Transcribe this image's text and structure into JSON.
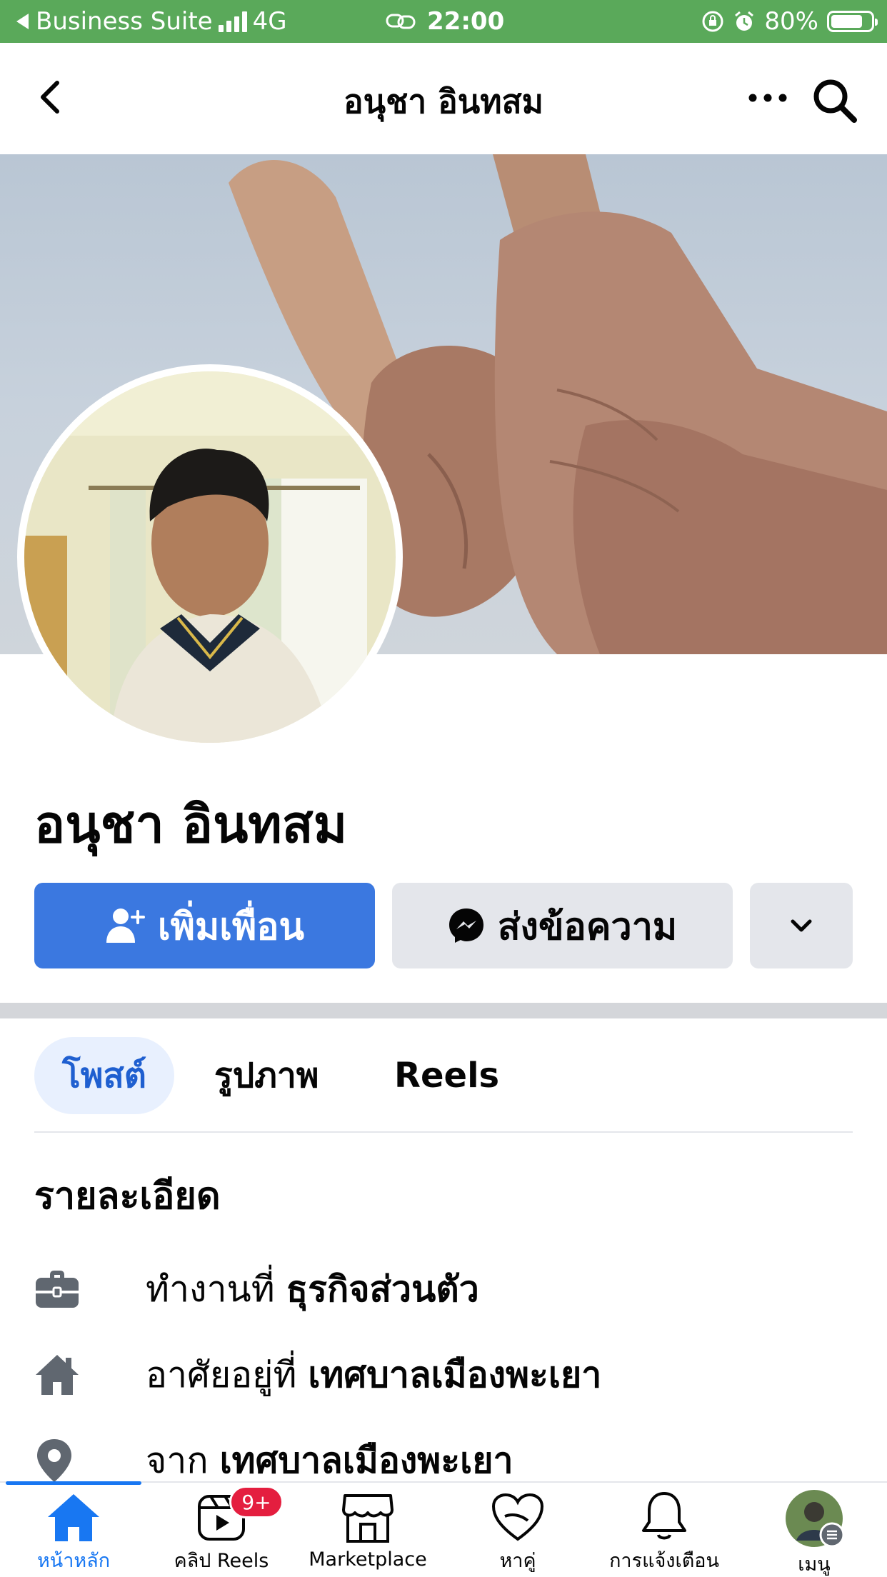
{
  "status_bar": {
    "back_app": "Business Suite",
    "network": "4G",
    "time": "22:00",
    "battery_percent": "80%",
    "battery_level": 0.8
  },
  "header": {
    "title": "อนุชา อินทสม"
  },
  "profile": {
    "name": "อนุชา อินทสม",
    "add_friend_label": "เพิ่มเพื่อน",
    "message_label": "ส่งข้อความ"
  },
  "tabs": [
    {
      "label": "โพสต์",
      "active": true
    },
    {
      "label": "รูปภาพ",
      "active": false
    },
    {
      "label": "Reels",
      "active": false
    }
  ],
  "details": {
    "title": "รายละเอียด",
    "rows": [
      {
        "icon": "briefcase-icon",
        "prefix": "ทำงานที่",
        "value": "ธุรกิจส่วนตัว"
      },
      {
        "icon": "home-icon",
        "prefix": "อาศัยอยู่ที่",
        "value": "เทศบาลเมืองพะเยา"
      },
      {
        "icon": "location-pin-icon",
        "prefix": "จาก",
        "value": "เทศบาลเมืองพะเยา"
      }
    ]
  },
  "bottom_nav": [
    {
      "label": "หน้าหลัก",
      "icon": "home-icon",
      "active": true
    },
    {
      "label": "คลิป Reels",
      "icon": "reels-icon",
      "badge": "9+"
    },
    {
      "label": "Marketplace",
      "icon": "shop-icon"
    },
    {
      "label": "หาคู่",
      "icon": "heart-icon"
    },
    {
      "label": "การแจ้งเตือน",
      "icon": "bell-icon"
    },
    {
      "label": "เมนู",
      "icon": "menu-avatar-icon"
    }
  ],
  "colors": {
    "status_bar": "#5aa95a",
    "primary_blue": "#3b78e0",
    "gray_button": "#e4e6eb",
    "badge_red": "#e41e3f"
  }
}
